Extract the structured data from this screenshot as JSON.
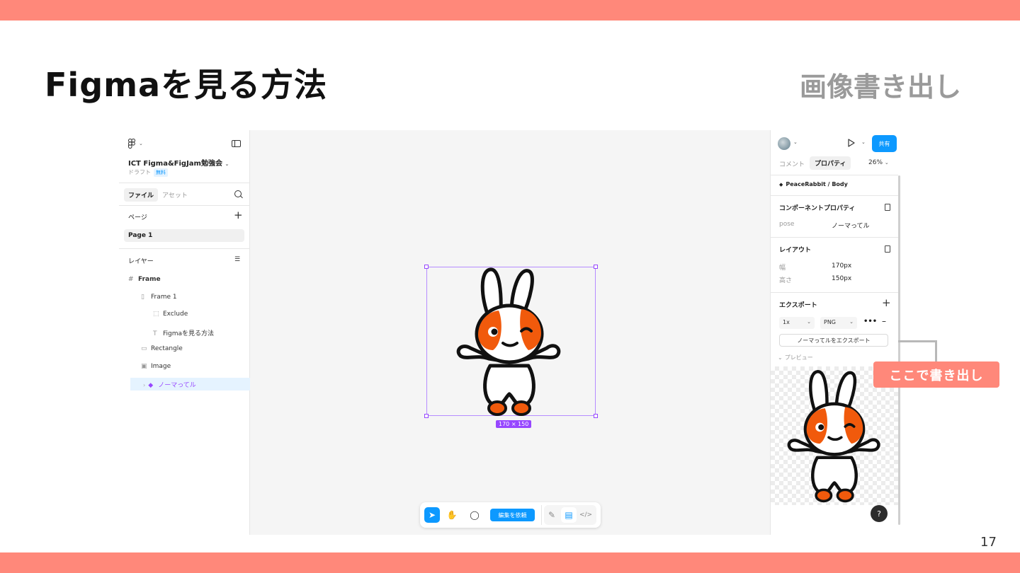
{
  "slide": {
    "title": "Figmaを見る方法",
    "section": "画像書き出し",
    "page_number": "17",
    "callout": "ここで書き出し",
    "accent_color": "#ff887a"
  },
  "left_panel": {
    "file_name": "ICT Figma&FigJam勉強会",
    "draft_label": "ドラフト",
    "plan_badge": "無料",
    "tab_file": "ファイル",
    "tab_assets": "アセット",
    "pages_header": "ページ",
    "page_item": "Page 1",
    "layers_header": "レイヤー",
    "layers": [
      {
        "label": "Frame",
        "icon": "frame-icon"
      },
      {
        "label": "Frame 1",
        "icon": "autolayout-icon"
      },
      {
        "label": "Exclude",
        "icon": "boolean-icon"
      },
      {
        "label": "Figmaを見る方法",
        "icon": "text-icon"
      },
      {
        "label": "Rectangle",
        "icon": "rectangle-icon"
      },
      {
        "label": "Image",
        "icon": "image-icon"
      },
      {
        "label": "ノーマってル",
        "icon": "component-instance-icon"
      }
    ]
  },
  "canvas": {
    "size_label": "170 × 150",
    "toolbar": {
      "request_edit": "編集を依頼"
    }
  },
  "right_panel": {
    "share": "共有",
    "tab_comment": "コメント",
    "tab_properties": "プロパティ",
    "zoom": "26%",
    "selection": "PeaceRabbit / Body",
    "component_props_title": "コンポーネントプロパティ",
    "prop_pose_label": "pose",
    "prop_pose_value": "ノーマってル",
    "layout_title": "レイアウト",
    "width_label": "幅",
    "width_value": "170px",
    "height_label": "高さ",
    "height_value": "150px",
    "export_title": "エクスポート",
    "export_scale": "1x",
    "export_format": "PNG",
    "export_button": "ノーマってルをエクスポート",
    "preview_label": "プレビュー",
    "help": "?"
  }
}
